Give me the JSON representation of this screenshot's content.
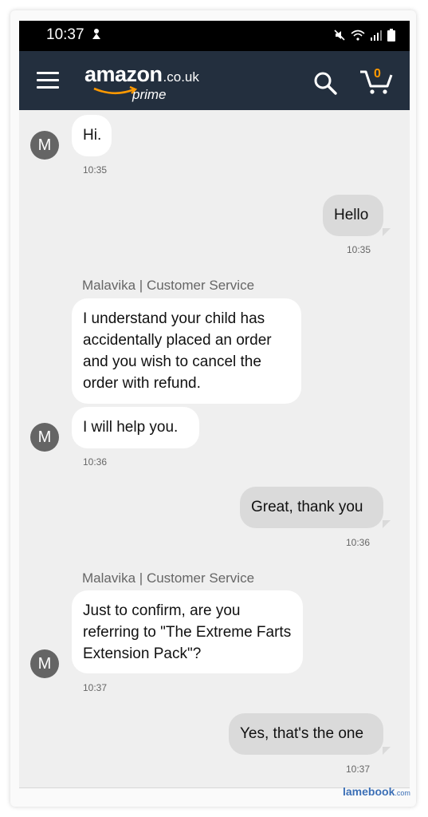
{
  "status_bar": {
    "time": "10:37"
  },
  "header": {
    "logo_main": "amazon",
    "logo_tld": ".co.uk",
    "logo_sub": "prime",
    "cart_count": "0"
  },
  "chat": {
    "m1": {
      "text": "Hi.",
      "time": "10:35",
      "avatar": "M"
    },
    "u1": {
      "text": "Hello",
      "time": "10:35"
    },
    "sender1": "Malavika | Customer Service",
    "m2": {
      "text": "I understand your child has accidentally placed an order and you wish to cancel the order with refund."
    },
    "m3": {
      "text": "I will help you.",
      "time": "10:36",
      "avatar": "M"
    },
    "u2": {
      "text": "Great, thank you",
      "time": "10:36"
    },
    "sender2": "Malavika | Customer Service",
    "m4": {
      "text": "Just to confirm, are you referring to \"The Extreme Farts Extension Pack\"?",
      "time": "10:37",
      "avatar": "M"
    },
    "u3": {
      "text": "Yes, that's the one",
      "time": "10:37"
    }
  },
  "watermark": {
    "main": "lamebook",
    "suffix": ".com"
  },
  "colors": {
    "header": "#232f3e",
    "accent": "#ff9900",
    "chat_bg": "#efefef",
    "user_bubble": "#dadada"
  }
}
